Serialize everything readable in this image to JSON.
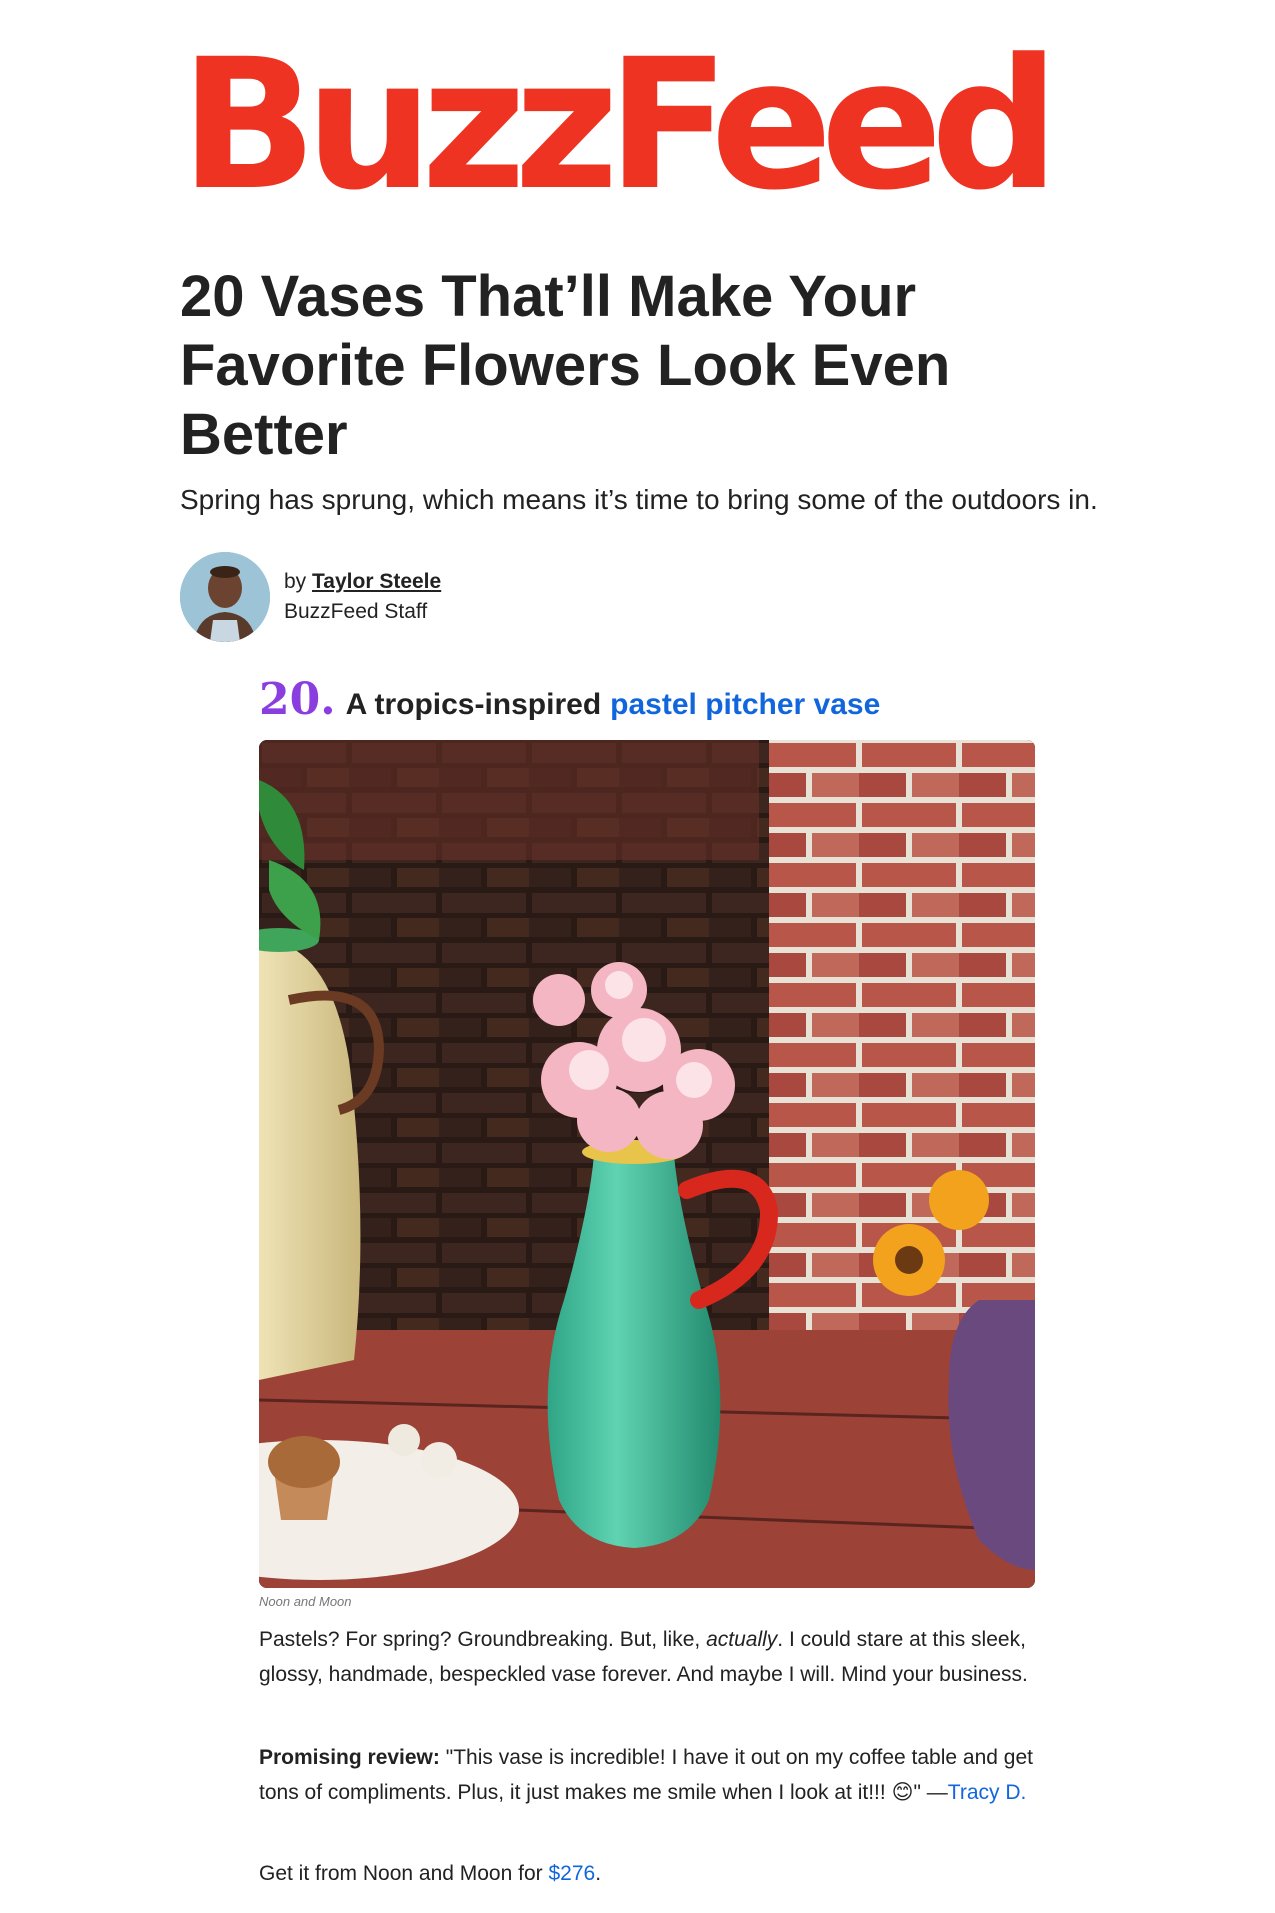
{
  "brand": {
    "logo_text": "BuzzFeed",
    "color": "#ee3322"
  },
  "article": {
    "headline": "20 Vases That’ll Make Your Favorite Flowers Look Even Better",
    "dek": "Spring has sprung, which means it’s time to bring some of the outdoors in."
  },
  "byline": {
    "prefix": "by",
    "author": "Taylor Steele",
    "role": "BuzzFeed Staff"
  },
  "item": {
    "number": "20.",
    "text": "A tropics-inspired",
    "link_text": "pastel pitcher vase",
    "number_color": "#8a3ee0",
    "link_color": "#1166dd",
    "image_credit": "Noon and Moon",
    "body": {
      "part1": "Pastels? For spring? Groundbreaking. But, like,",
      "emphasis": "actually",
      "part2": ". I could stare at this sleek, glossy, handmade, bespeckled vase forever. And maybe I will. Mind your business."
    },
    "review": {
      "label": "Promising review:",
      "quote": "\"This vase is incredible! I have it out on my coffee table and get tons of compliments. Plus, it just makes me smile when I look at it!!! ",
      "emoji": "😊",
      "quote_end": "\" —",
      "reviewer": "Tracy D."
    },
    "cta": {
      "prefix": "Get it from Noon and Moon for",
      "price": "$276",
      "suffix": "."
    }
  }
}
